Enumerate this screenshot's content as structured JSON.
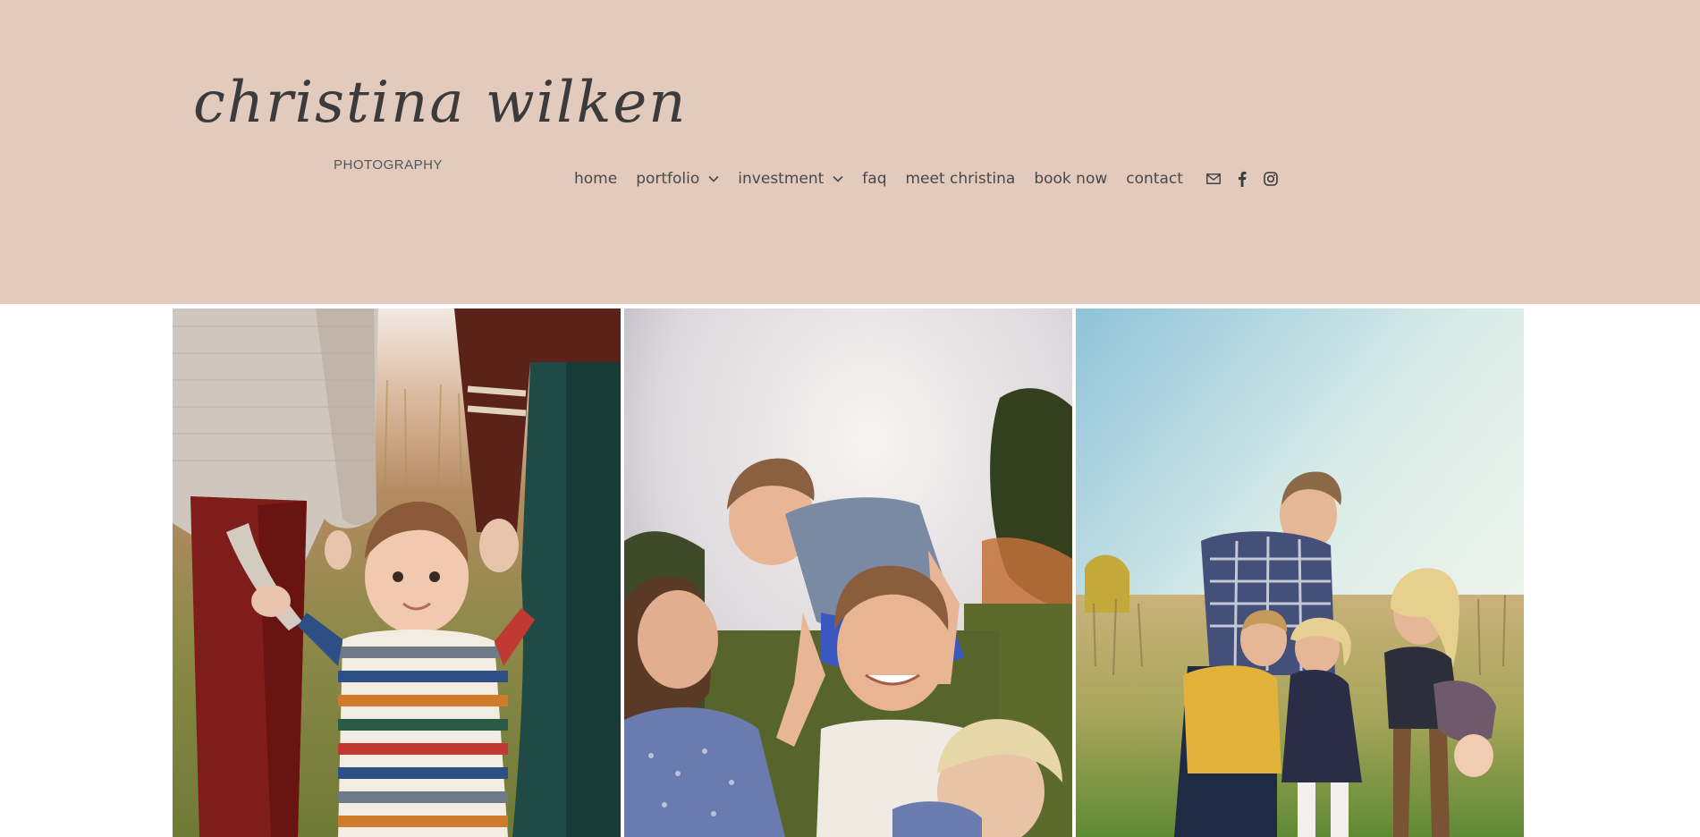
{
  "logo": {
    "script_text": "christina wilken",
    "subtitle": "PHOTOGRAPHY"
  },
  "nav": {
    "items": [
      {
        "label": "home",
        "has_dropdown": false
      },
      {
        "label": "portfolio",
        "has_dropdown": true
      },
      {
        "label": "investment",
        "has_dropdown": true
      },
      {
        "label": "faq",
        "has_dropdown": false
      },
      {
        "label": "meet christina",
        "has_dropdown": false
      },
      {
        "label": "book now",
        "has_dropdown": false
      },
      {
        "label": "contact",
        "has_dropdown": false
      }
    ],
    "social_icons": [
      "mail-icon",
      "facebook-icon",
      "instagram-icon"
    ]
  },
  "colors": {
    "header_bg": "#e2cbbd",
    "text": "#4b4747",
    "page_bg": "#ffffff"
  },
  "gallery": {
    "photos": [
      {
        "name": "family-toddler-walking-photo"
      },
      {
        "name": "family-kiss-shoulders-photo"
      },
      {
        "name": "family-field-laughing-photo"
      }
    ]
  }
}
